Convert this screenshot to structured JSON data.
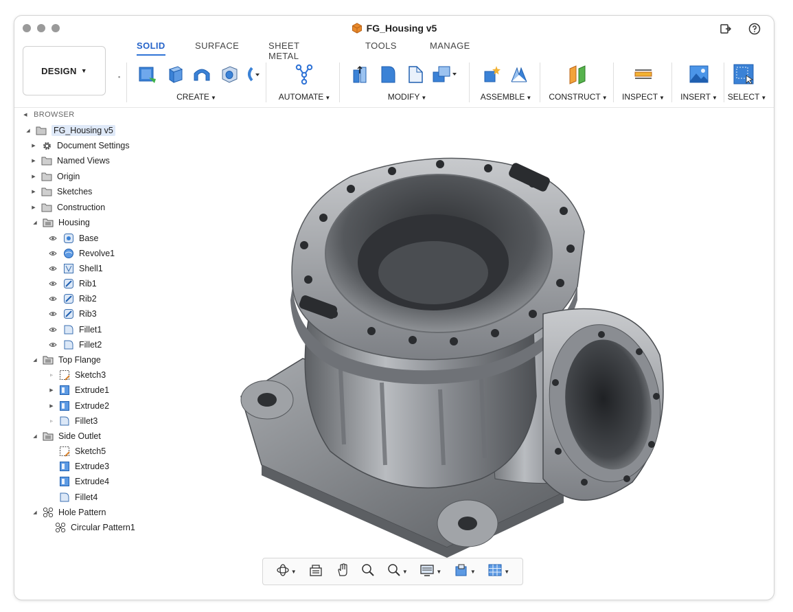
{
  "window": {
    "title": "FG_Housing v5"
  },
  "tabs": [
    {
      "label": "SOLID",
      "active": true
    },
    {
      "label": "SURFACE",
      "active": false
    },
    {
      "label": "SHEET METAL",
      "active": false
    },
    {
      "label": "TOOLS",
      "active": false
    },
    {
      "label": "MANAGE",
      "active": false
    }
  ],
  "workspace": {
    "label": "DESIGN"
  },
  "toolbar": {
    "groups": [
      {
        "label": "CREATE"
      },
      {
        "label": "AUTOMATE"
      },
      {
        "label": "MODIFY"
      },
      {
        "label": "ASSEMBLE"
      },
      {
        "label": "CONSTRUCT"
      },
      {
        "label": "INSPECT"
      },
      {
        "label": "INSERT"
      },
      {
        "label": "SELECT"
      }
    ]
  },
  "browser": {
    "heading": "BROWSER",
    "root": "FG_Housing v5",
    "items": [
      {
        "label": "Document Settings",
        "icon": "gear-icon"
      },
      {
        "label": "Named Views",
        "icon": "folder-icon"
      },
      {
        "label": "Origin",
        "icon": "folder-icon"
      },
      {
        "label": "Sketches",
        "icon": "folder-icon"
      },
      {
        "label": "Construction",
        "icon": "folder-icon"
      },
      {
        "label": "Housing",
        "icon": "component-icon"
      },
      {
        "label": "Base",
        "icon": "sketch-feature-icon"
      },
      {
        "label": "Revolve1",
        "icon": "revolve-icon"
      },
      {
        "label": "Shell1",
        "icon": "shell-icon"
      },
      {
        "label": "Rib1",
        "icon": "rib-icon"
      },
      {
        "label": "Rib2",
        "icon": "rib-icon"
      },
      {
        "label": "Rib3",
        "icon": "rib-icon"
      },
      {
        "label": "Fillet1",
        "icon": "fillet-icon"
      },
      {
        "label": "Fillet2",
        "icon": "fillet-icon"
      },
      {
        "label": "Top Flange",
        "icon": "component-icon"
      },
      {
        "label": "Sketch3",
        "icon": "sketch-icon"
      },
      {
        "label": "Extrude1",
        "icon": "extrude-icon"
      },
      {
        "label": "Extrude2",
        "icon": "extrude-icon"
      },
      {
        "label": "Fillet3",
        "icon": "fillet-icon"
      },
      {
        "label": "Side Outlet",
        "icon": "component-icon"
      },
      {
        "label": "Sketch5",
        "icon": "sketch-icon"
      },
      {
        "label": "Extrude3",
        "icon": "extrude-icon"
      },
      {
        "label": "Extrude4",
        "icon": "extrude-icon"
      },
      {
        "label": "Fillet4",
        "icon": "fillet-icon"
      },
      {
        "label": "Hole Pattern",
        "icon": "pattern-icon"
      },
      {
        "label": "Circular Pattern1",
        "icon": "pattern-icon"
      }
    ]
  },
  "nav_bar": {
    "tools": [
      "orbit-icon",
      "look-at-icon",
      "pan-icon",
      "zoom-icon",
      "zoom-window-icon",
      "display-settings-icon",
      "visual-style-icon",
      "grid-icon"
    ]
  },
  "colors": {
    "accent": "#2f73d6",
    "tool_blue": "#3b82d6",
    "metal": "#8e9196"
  }
}
